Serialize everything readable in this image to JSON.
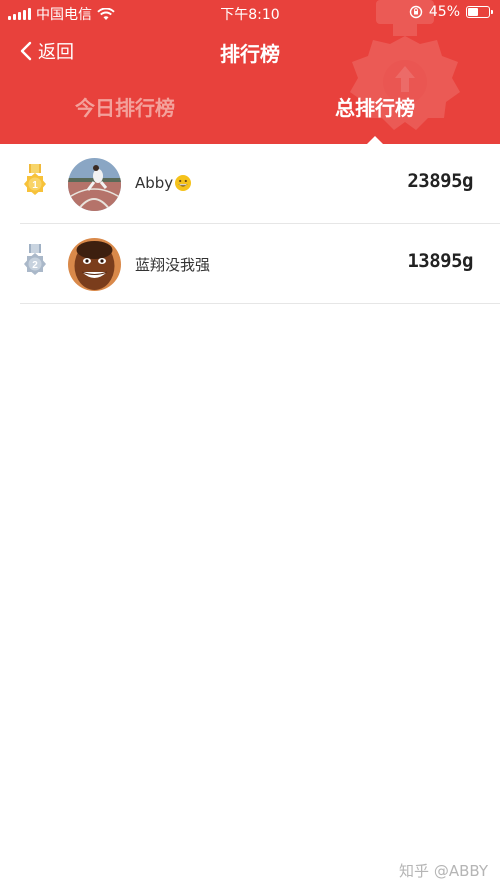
{
  "status_bar": {
    "carrier": "中国电信",
    "time": "下午8:10",
    "battery_percent": "45%",
    "battery_level": 0.45
  },
  "nav": {
    "back_label": "返回",
    "title": "排行榜"
  },
  "tabs": [
    {
      "label": "今日排行榜",
      "active": false
    },
    {
      "label": "总排行榜",
      "active": true
    }
  ],
  "ranking": [
    {
      "rank": 1,
      "name": "Abby",
      "score": "23895g",
      "medal": "gold"
    },
    {
      "rank": 2,
      "name": "蓝翔没我强",
      "score": "13895g",
      "medal": "silver"
    }
  ],
  "watermark": "知乎 @ABBY",
  "colors": {
    "header_red": "#e8413c",
    "inactive_tab": "#f3a19b",
    "gold": "#f7c23a",
    "silver": "#aab8c9"
  }
}
